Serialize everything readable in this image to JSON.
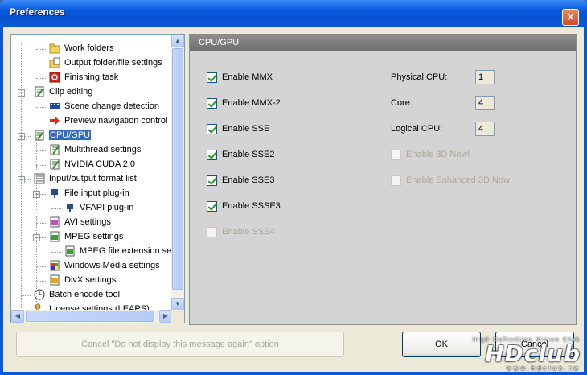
{
  "window": {
    "title": "Preferences"
  },
  "tree": {
    "items": [
      {
        "label": "Work folders",
        "icon": "folder-icon"
      },
      {
        "label": "Output folder/file settings",
        "icon": "folder-file-icon"
      },
      {
        "label": "Finishing task",
        "icon": "power-icon"
      },
      {
        "label": "Clip editing",
        "icon": "edit-icon"
      },
      {
        "label": "Scene change detection",
        "icon": "film-icon"
      },
      {
        "label": "Preview navigation control",
        "icon": "red-arrow-icon"
      },
      {
        "label": "CPU/GPU",
        "icon": "edit-icon"
      },
      {
        "label": "Multithread settings",
        "icon": "edit-icon"
      },
      {
        "label": "NVIDIA CUDA 2.0",
        "icon": "edit-icon"
      },
      {
        "label": "Input/output format list",
        "icon": "list-icon"
      },
      {
        "label": "File input plug-in",
        "icon": "plug-icon"
      },
      {
        "label": "VFAPI plug-in",
        "icon": "plug-icon"
      },
      {
        "label": "AVI settings",
        "icon": "avi-icon"
      },
      {
        "label": "MPEG settings",
        "icon": "mpeg-icon"
      },
      {
        "label": "MPEG file extension settings",
        "icon": "mpeg-icon"
      },
      {
        "label": "Windows Media settings",
        "icon": "wm-icon"
      },
      {
        "label": "DivX settings",
        "icon": "divx-icon"
      },
      {
        "label": "Batch encode tool",
        "icon": "clock-icon"
      },
      {
        "label": "License settings (LEAPS)",
        "icon": "key-icon"
      }
    ],
    "selected": "CPU/GPU"
  },
  "panel": {
    "title": "CPU/GPU",
    "left_options": [
      {
        "label": "Enable MMX",
        "checked": true,
        "enabled": true
      },
      {
        "label": "Enable MMX-2",
        "checked": true,
        "enabled": true
      },
      {
        "label": "Enable SSE",
        "checked": true,
        "enabled": true
      },
      {
        "label": "Enable SSE2",
        "checked": true,
        "enabled": true
      },
      {
        "label": "Enable SSE3",
        "checked": true,
        "enabled": true
      },
      {
        "label": "Enable SSSE3",
        "checked": true,
        "enabled": true
      },
      {
        "label": "Enable SSE4",
        "checked": false,
        "enabled": false
      }
    ],
    "fields": [
      {
        "label": "Physical CPU:",
        "value": "1"
      },
      {
        "label": "Core:",
        "value": "4"
      },
      {
        "label": "Logical CPU:",
        "value": "4"
      }
    ],
    "right_options": [
      {
        "label": "Enable 3D Now!",
        "checked": false,
        "enabled": false
      },
      {
        "label": "Enable Enhanced 3D Now!",
        "checked": false,
        "enabled": false
      }
    ]
  },
  "buttons": {
    "dont_display": "Cancel \"Do not display this message again\" option",
    "ok": "OK",
    "cancel": "Cancel"
  },
  "watermark": {
    "tagline": "High Definition Vision Club",
    "logo": "HDclub",
    "url": "www.hdclub.tw"
  }
}
